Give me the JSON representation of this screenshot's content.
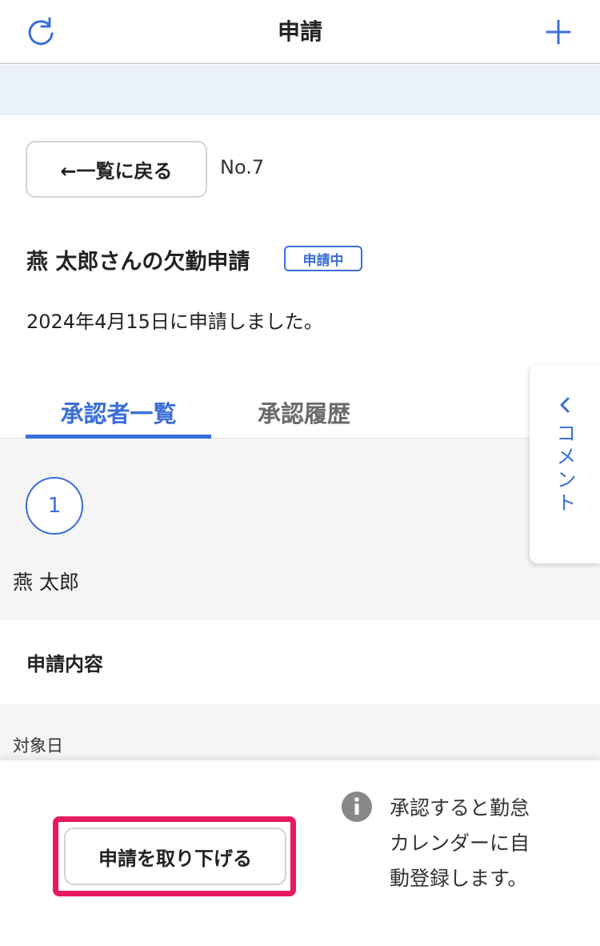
{
  "header": {
    "title": "申請",
    "refresh_icon": "refresh-icon",
    "add_icon": "plus-icon"
  },
  "detail": {
    "back_label": "←一覧に戻る",
    "number": "No.7",
    "title": "燕 太郎さんの欠勤申請",
    "status": "申請中",
    "submitted_text": "2024年4月15日に申請しました。"
  },
  "tabs": [
    {
      "label": "承認者一覧",
      "active": true
    },
    {
      "label": "承認履歴",
      "active": false
    }
  ],
  "approvers": [
    {
      "step": "1",
      "name": "燕 太郎"
    }
  ],
  "comment_tab": {
    "label": "コメント",
    "icon": "chevron-left-icon"
  },
  "content": {
    "section_title": "申請内容",
    "target_date_label": "対象日"
  },
  "bottom_bar": {
    "withdraw_label": "申請を取り下げる",
    "info_text": "承認すると勤怠カレンダーに自動登録します。",
    "info_icon": "info-icon"
  },
  "colors": {
    "accent": "#3a6fd8",
    "highlight": "#e8195f",
    "band": "#ebf1fb"
  }
}
